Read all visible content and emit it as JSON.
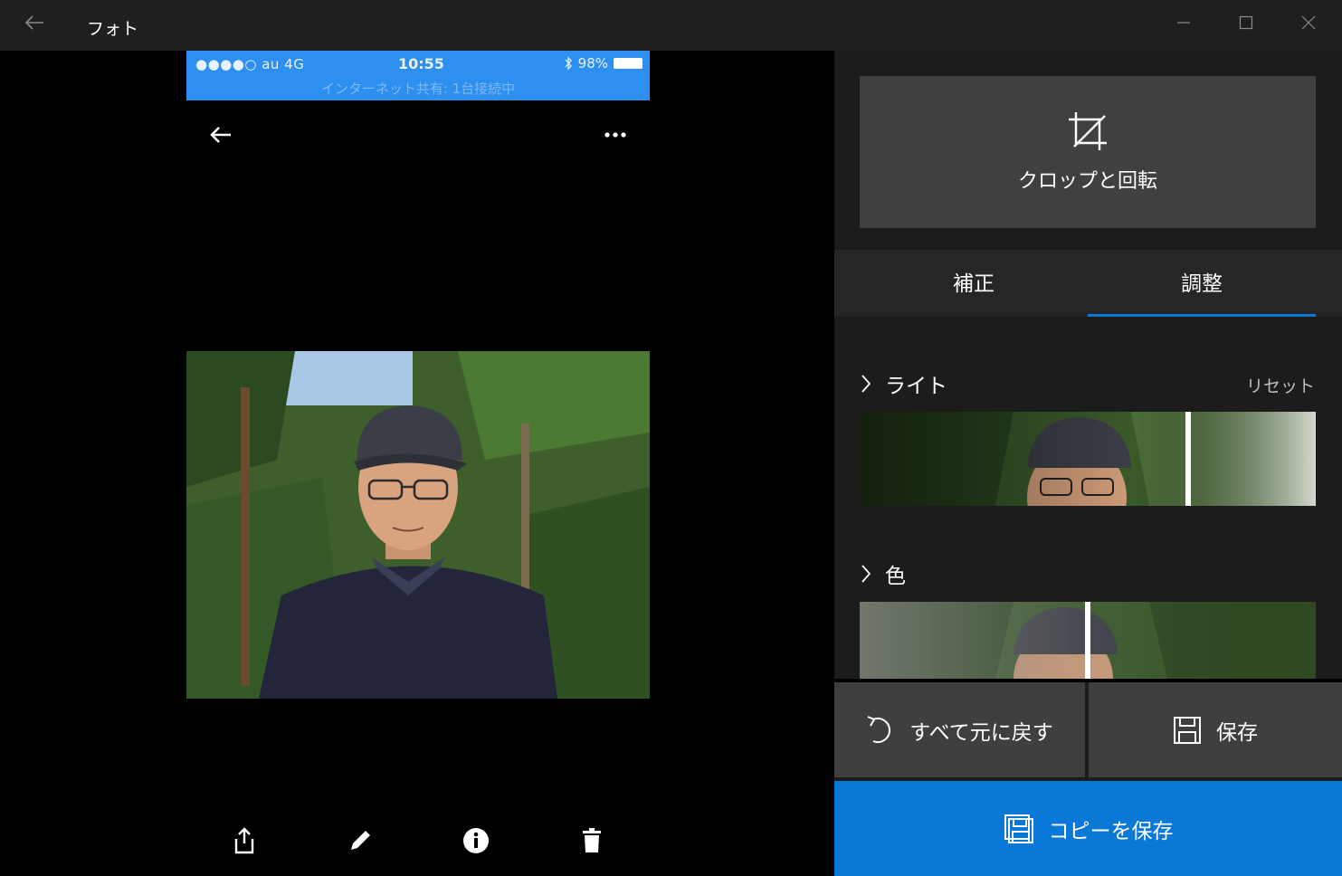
{
  "window": {
    "title": "フォト",
    "minimize_icon": "minimize-icon",
    "maximize_icon": "maximize-icon",
    "close_icon": "close-icon"
  },
  "phone": {
    "carrier": "●●●●○ au  4G",
    "time": "10:55",
    "battery": "98%",
    "hotspot": "インターネット共有: 1台接続中"
  },
  "panel": {
    "crop_label": "クロップと回転",
    "tabs": [
      {
        "label": "補正",
        "selected": false
      },
      {
        "label": "調整",
        "selected": true
      }
    ],
    "sections": [
      {
        "title": "ライト",
        "reset": "リセット",
        "slider_value": 0.72
      },
      {
        "title": "色",
        "slider_value": 0.5
      }
    ],
    "undo_all_label": "すべて元に戻す",
    "save_label": "保存",
    "save_copy_label": "コピーを保存"
  },
  "colors": {
    "accent": "#0a78d7",
    "panel_bg": "#1c1c1c",
    "button_bg": "#3f3f3f",
    "titlebar_bg": "#1f1f1f",
    "phone_status_bg": "#2d8ff0"
  }
}
